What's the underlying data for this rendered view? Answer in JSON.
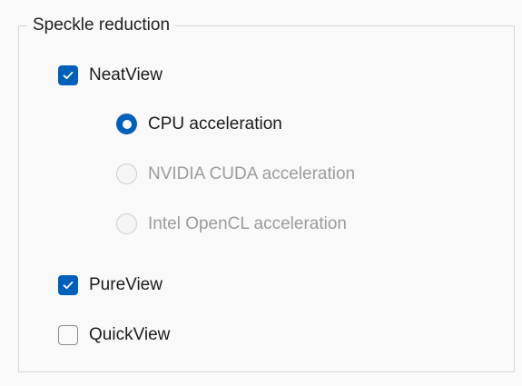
{
  "group": {
    "title": "Speckle reduction"
  },
  "options": {
    "neatview": {
      "label": "NeatView",
      "checked": true
    },
    "cpu": {
      "label": "CPU acceleration",
      "selected": true,
      "enabled": true
    },
    "cuda": {
      "label": "NVIDIA CUDA acceleration",
      "selected": false,
      "enabled": false
    },
    "opencl": {
      "label": "Intel OpenCL acceleration",
      "selected": false,
      "enabled": false
    },
    "pureview": {
      "label": "PureView",
      "checked": true
    },
    "quickview": {
      "label": "QuickView",
      "checked": false
    }
  },
  "colors": {
    "accent": "#005fb8",
    "disabled_text": "#9c9c9c",
    "background": "#f9f9f9"
  },
  "icons": {
    "checkbox_checked": "check-mark-icon"
  }
}
